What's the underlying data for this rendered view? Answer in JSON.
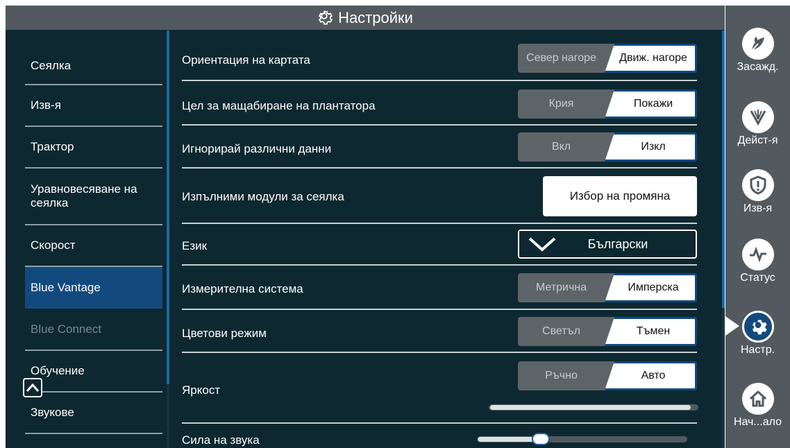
{
  "header": {
    "title": "Настройки",
    "icon": "gear-icon"
  },
  "sidebar": {
    "items": [
      {
        "label": "Сеялка"
      },
      {
        "label": "Изв-я"
      },
      {
        "label": "Трактор"
      },
      {
        "label": "Уравновесяване на сеялка"
      },
      {
        "label": "Скорост"
      },
      {
        "label": "Blue Vantage",
        "active": true
      },
      {
        "label": "Blue Connect",
        "disabled": true
      },
      {
        "label": "Обучение"
      },
      {
        "label": "Звукове"
      }
    ]
  },
  "settings": {
    "map_orientation": {
      "label": "Ориентация на картата",
      "off": "Север нагоре",
      "on": "Движ. нагоре"
    },
    "planter_zoom": {
      "label": "Цел за мащабиране на плантатора",
      "off": "Крия",
      "on": "Покажи"
    },
    "ignore_data": {
      "label": "Игнорирай различни данни",
      "off": "Вкл",
      "on": "Изкл"
    },
    "planter_modules": {
      "label": "Изпълними модули за сеялка",
      "button": "Избор на промяна"
    },
    "language": {
      "label": "Език",
      "value": "Български"
    },
    "units": {
      "label": "Измерителна система",
      "off": "Метрична",
      "on": "Имперска"
    },
    "color_mode": {
      "label": "Цветови режим",
      "off": "Светъл",
      "on": "Тъмен"
    },
    "brightness": {
      "label": "Яркост",
      "off": "Ръчно",
      "on": "Авто",
      "level": 0.97
    },
    "volume": {
      "label": "Сила на звука",
      "level": 0.3
    }
  },
  "rightnav": {
    "items": [
      {
        "label": "Засажд.",
        "icon": "planting-icon"
      },
      {
        "label": "Дейст-я",
        "icon": "actions-icon"
      },
      {
        "label": "Изв-я",
        "icon": "alerts-shield-icon"
      },
      {
        "label": "Статус",
        "icon": "status-pulse-icon"
      },
      {
        "label": "Настр.",
        "icon": "settings-gear-icon",
        "active": true
      },
      {
        "label": "Нач...ало",
        "icon": "home-icon"
      }
    ]
  },
  "colors": {
    "background": "#0d2830",
    "header": "#525a5f",
    "accent": "#134a7d",
    "toggle_off": "#5d6468"
  }
}
